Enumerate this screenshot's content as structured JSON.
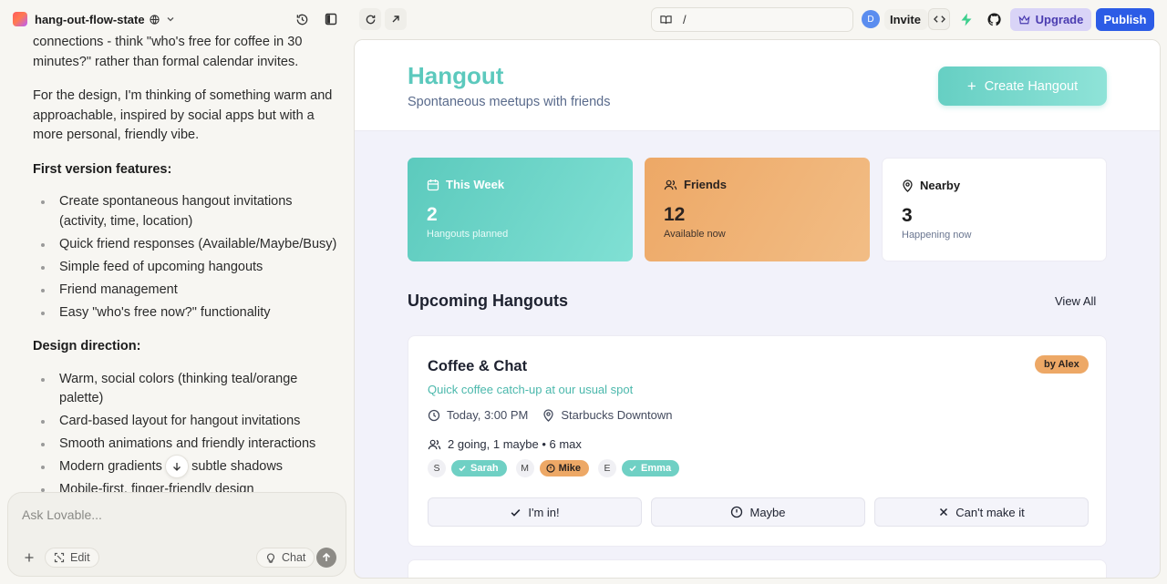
{
  "project": {
    "name": "hang-out-flow-state"
  },
  "chat": {
    "paragraphs": [
      "connections - think \"who's free for coffee in 30 minutes?\" rather than formal calendar invites.",
      "For the design, I'm thinking of something warm and approachable, inspired by social apps but with a more personal, friendly vibe."
    ],
    "features_heading": "First version features:",
    "features": [
      "Create spontaneous hangout invitations (activity, time, location)",
      "Quick friend responses (Available/Maybe/Busy)",
      "Simple feed of upcoming hangouts",
      "Friend management",
      "Easy \"who's free now?\" functionality"
    ],
    "design_heading": "Design direction:",
    "design_items": [
      "Warm, social colors (thinking teal/orange palette)",
      "Card-based layout for hangout invitations",
      "Smooth animations and friendly interactions",
      "Modern gradients and subtle shadows",
      "Mobile-first, finger-friendly design"
    ]
  },
  "composer": {
    "placeholder": "Ask Lovable...",
    "edit_label": "Edit",
    "chat_label": "Chat"
  },
  "toolbar": {
    "url_path": "/",
    "avatar_initial": "D",
    "invite_label": "Invite",
    "upgrade_label": "Upgrade",
    "publish_label": "Publish"
  },
  "app": {
    "title": "Hangout",
    "subtitle": "Spontaneous meetups with friends",
    "create_label": "Create Hangout",
    "stats": [
      {
        "label": "This Week",
        "value": "2",
        "sub": "Hangouts planned"
      },
      {
        "label": "Friends",
        "value": "12",
        "sub": "Available now"
      },
      {
        "label": "Nearby",
        "value": "3",
        "sub": "Happening now"
      }
    ],
    "section_title": "Upcoming Hangouts",
    "view_all": "View All",
    "hangout": {
      "title": "Coffee & Chat",
      "by": "by Alex",
      "description": "Quick coffee catch-up at our usual spot",
      "time": "Today, 3:00 PM",
      "location": "Starbucks Downtown",
      "going": "2 going, 1 maybe • 6 max",
      "attendees": [
        {
          "initial": "S",
          "name": "Sarah",
          "status": "available"
        },
        {
          "initial": "M",
          "name": "Mike",
          "status": "maybe"
        },
        {
          "initial": "E",
          "name": "Emma",
          "status": "available"
        }
      ],
      "rsvp": {
        "in": "I'm in!",
        "maybe": "Maybe",
        "cant": "Can't make it"
      }
    }
  },
  "colors": {
    "teal": "#5cc9bd",
    "orange": "#eda866",
    "publish": "#2c5ce6",
    "upgrade_bg": "#d9d4f7"
  },
  "icons": [
    "globe-icon",
    "chevron-down-icon",
    "history-icon",
    "sidebar-toggle-icon",
    "refresh-icon",
    "external-link-icon",
    "book-icon",
    "code-icon",
    "bolt-icon",
    "github-icon",
    "crown-icon",
    "calendar-icon",
    "users-icon",
    "map-pin-icon",
    "clock-icon",
    "check-icon",
    "alert-circle-icon",
    "x-icon",
    "arrow-down-icon",
    "plus-icon",
    "edit-icon",
    "lightbulb-icon",
    "arrow-up-icon"
  ]
}
